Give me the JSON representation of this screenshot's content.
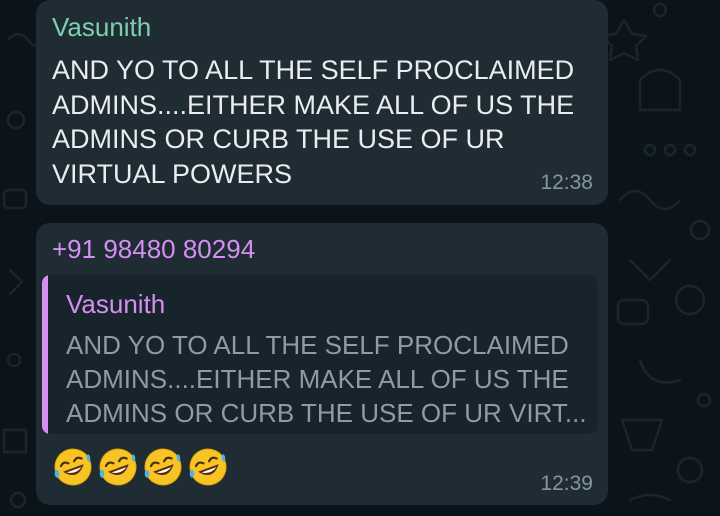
{
  "theme": {
    "background": "#0b141a",
    "bubble": "#1f2c34",
    "sender_color_vasunith": "#7fcfae",
    "sender_color_number": "#d48ff0",
    "text": "#e9edef",
    "timestamp": "#8696a0"
  },
  "messages": [
    {
      "sender": "Vasunith",
      "text": "AND YO TO ALL THE SELF PROCLAIMED ADMINS....EITHER MAKE ALL OF US THE ADMINS OR CURB THE USE OF UR VIRTUAL POWERS",
      "time": "12:38"
    },
    {
      "sender": "+91 98480 80294",
      "quoted": {
        "sender": "Vasunith",
        "text": "AND YO TO ALL THE SELF PROCLAIMED ADMINS....EITHER MAKE ALL OF US THE ADMINS OR CURB THE USE OF UR VIRT..."
      },
      "emojis": [
        "rolling-on-floor-laughing-emoji",
        "rolling-on-floor-laughing-emoji",
        "rolling-on-floor-laughing-emoji",
        "rolling-on-floor-laughing-emoji"
      ],
      "time": "12:39"
    }
  ]
}
